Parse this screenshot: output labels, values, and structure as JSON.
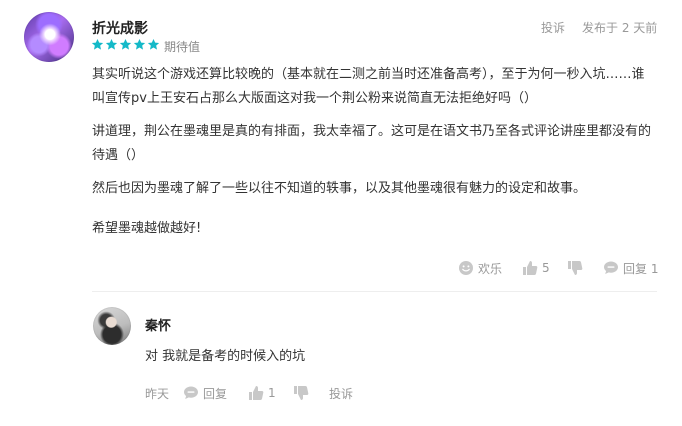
{
  "comment": {
    "username": "折光成影",
    "stars": 5,
    "rating_label": "期待值",
    "report": "投诉",
    "time": "发布于 2 天前",
    "paragraphs": [
      "其实听说这个游戏还算比较晚的（基本就在二测之前当时还准备高考），至于为何一秒入坑……谁叫宣传pv上王安石占那么大版面这对我一个荆公粉来说简直无法拒绝好吗（）",
      "讲道理，荆公在墨魂里是真的有排面，我太幸福了。这可是在语文书乃至各式评论讲座里都没有的待遇（）",
      "然后也因为墨魂了解了一些以往不知道的轶事，以及其他墨魂很有魅力的设定和故事。",
      "希望墨魂越做越好!"
    ],
    "actions": {
      "fun_label": "欢乐",
      "like_count": "5",
      "reply_label": "回复 1"
    }
  },
  "reply": {
    "username": "秦怀",
    "text": "对 我就是备考的时候入的坑",
    "time": "昨天",
    "reply_label": "回复",
    "like_count": "1",
    "report": "投诉"
  },
  "colors": {
    "star": "#14b9c8",
    "muted": "#999999",
    "text": "#333333"
  }
}
